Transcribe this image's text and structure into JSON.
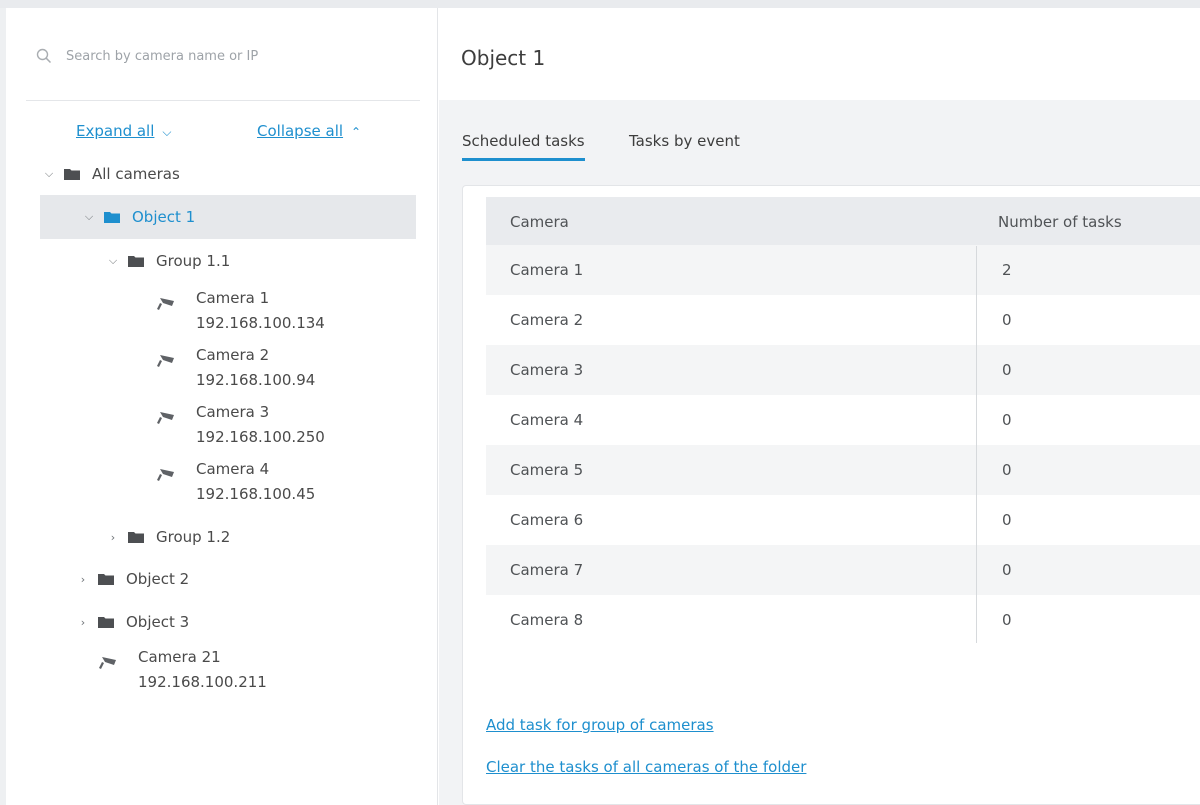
{
  "sidebar": {
    "search_placeholder": "Search by camera name or IP",
    "expand_all": "Expand all",
    "collapse_all": "Collapse all",
    "tree": {
      "root": "All cameras",
      "object1": "Object 1",
      "group11": "Group 1.1",
      "cameras": [
        {
          "name": "Camera 1",
          "ip": "192.168.100.134"
        },
        {
          "name": "Camera 2",
          "ip": "192.168.100.94"
        },
        {
          "name": "Camera 3",
          "ip": "192.168.100.250"
        },
        {
          "name": "Camera 4",
          "ip": "192.168.100.45"
        }
      ],
      "group12": "Group 1.2",
      "object2": "Object 2",
      "object3": "Object 3",
      "camera21": {
        "name": "Camera 21",
        "ip": "192.168.100.211"
      }
    }
  },
  "main": {
    "title": "Object 1",
    "tabs": [
      {
        "label": "Scheduled tasks",
        "active": true
      },
      {
        "label": "Tasks by event",
        "active": false
      }
    ],
    "table": {
      "headers": {
        "camera": "Camera",
        "count": "Number of tasks"
      },
      "rows": [
        {
          "camera": "Camera 1",
          "count": "2"
        },
        {
          "camera": "Camera 2",
          "count": "0"
        },
        {
          "camera": "Camera 3",
          "count": "0"
        },
        {
          "camera": "Camera 4",
          "count": "0"
        },
        {
          "camera": "Camera 5",
          "count": "0"
        },
        {
          "camera": "Camera 6",
          "count": "0"
        },
        {
          "camera": "Camera 7",
          "count": "0"
        },
        {
          "camera": "Camera 8",
          "count": "0"
        }
      ]
    },
    "links": {
      "add_task": "Add task for group of cameras",
      "clear_tasks": "Clear the tasks of all cameras of the folder"
    }
  },
  "colors": {
    "accent": "#1e8fce",
    "selected_bg": "#e6e8eb",
    "header_bg": "#e9ebee",
    "folder": "#4d4f52"
  },
  "icons": [
    "search-icon",
    "chevron-down-icon",
    "chevron-up-icon",
    "chevron-right-icon",
    "folder-icon",
    "camera-icon"
  ]
}
